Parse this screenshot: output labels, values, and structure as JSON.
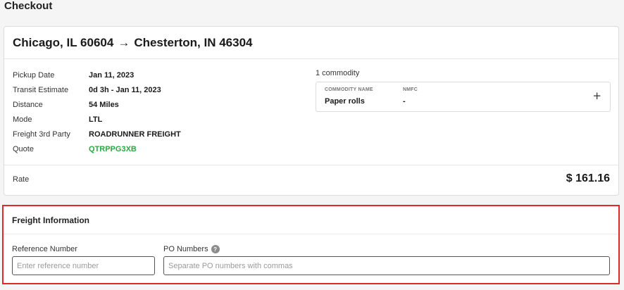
{
  "page": {
    "title": "Checkout"
  },
  "route": {
    "origin": "Chicago, IL 60604",
    "arrow": "→",
    "destination": "Chesterton, IN 46304"
  },
  "details": [
    {
      "label": "Pickup Date",
      "value": "Jan 11, 2023"
    },
    {
      "label": "Transit Estimate",
      "value": "0d 3h - Jan 11, 2023"
    },
    {
      "label": "Distance",
      "value": "54 Miles"
    },
    {
      "label": "Mode",
      "value": "LTL"
    },
    {
      "label": "Freight 3rd Party",
      "value": "ROADRUNNER FREIGHT"
    },
    {
      "label": "Quote",
      "value": "QTRPPG3XB"
    }
  ],
  "commodities": {
    "count_label": "1 commodity",
    "headers": {
      "name": "COMMODITY NAME",
      "nmfc": "NMFC"
    },
    "items": [
      {
        "name": "Paper rolls",
        "nmfc": "-"
      }
    ],
    "add_icon": "+"
  },
  "rate": {
    "label": "Rate",
    "value": "$ 161.16"
  },
  "freight": {
    "title": "Freight Information",
    "reference_label": "Reference Number",
    "reference_placeholder": "Enter reference number",
    "reference_value": "",
    "po_label": "PO Numbers",
    "po_help_icon": "?",
    "po_placeholder": "Separate PO numbers with commas",
    "po_value": ""
  },
  "colors": {
    "quote": "#2aa845",
    "highlight_border": "#e02a2a"
  }
}
